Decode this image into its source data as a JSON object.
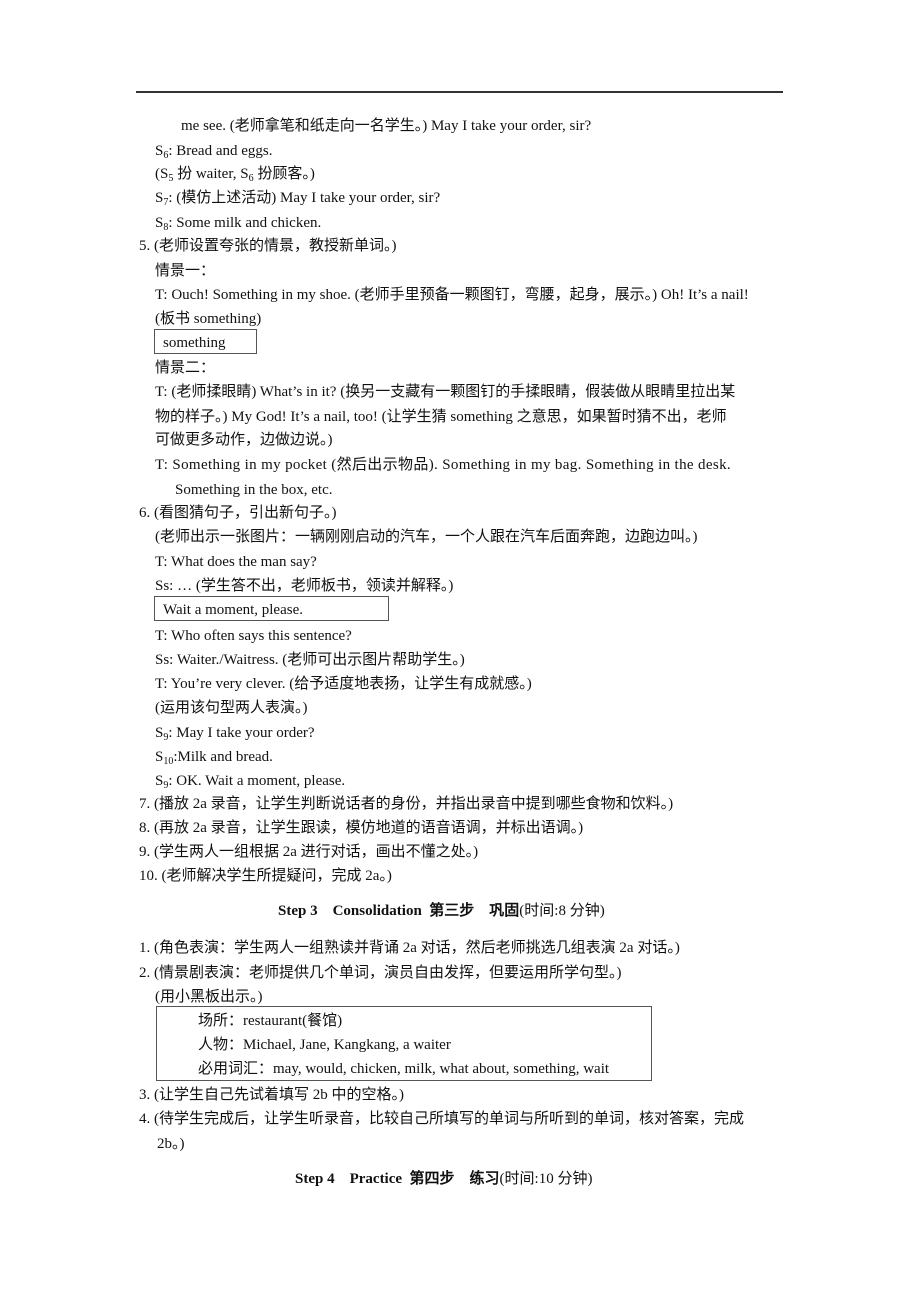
{
  "document": {
    "lines": {
      "l01": "me see. (老师拿笔和纸走向一名学生。) May I take your order, sir?",
      "l02_speaker": "S",
      "l02_sub": "6",
      "l02_text": ": Bread and eggs.",
      "l03_a": "(S",
      "l03_sub1": "5",
      "l03_b": " 扮 waiter, S",
      "l03_sub2": "6",
      "l03_c": " 扮顾客。)",
      "l04_speaker": "S",
      "l04_sub": "7",
      "l04_text": ": (模仿上述活动) May I take your order, sir?",
      "l05_speaker": "S",
      "l05_sub": "8",
      "l05_text": ": Some milk and chicken.",
      "l06": "5. (老师设置夸张的情景，教授新单词。)",
      "l07": "情景一：",
      "l08": "T: Ouch! Something in my shoe. (老师手里预备一颗图钉，弯腰，起身，展示。) Oh! It’s a nail!",
      "l09": "(板书 something)",
      "box1": "something",
      "l10": "情景二：",
      "l11": "T: (老师揉眼睛) What’s in it? (换另一支藏有一颗图钉的手揉眼睛，假装做从眼睛里拉出某",
      "l12": "物的样子。) My God! It’s a nail, too! (让学生猜 something 之意思，如果暂时猜不出，老师",
      "l13": "可做更多动作，边做边说。)",
      "l14": "T: Something in my pocket (然后出示物品). Something in my bag. Something in the desk.",
      "l15": "Something in the box, etc.",
      "l16": "6. (看图猜句子，引出新句子。)",
      "l17": "(老师出示一张图片：一辆刚刚启动的汽车，一个人跟在汽车后面奔跑，边跑边叫。)",
      "l18": "T: What does the man say?",
      "l19": "Ss: … (学生答不出，老师板书，领读并解释。)",
      "box2": "Wait a moment, please.",
      "l20": "T: Who often says this sentence?",
      "l21": "Ss: Waiter./Waitress. (老师可出示图片帮助学生。)",
      "l22": "T: You’re very clever. (给予适度地表扬，让学生有成就感。)",
      "l23": "(运用该句型两人表演。)",
      "l24_speaker": "S",
      "l24_sub": "9",
      "l24_text": ":  May I take your order?",
      "l25_speaker": "S",
      "l25_sub": "10",
      "l25_text": ":Milk and bread.",
      "l26_speaker": "S",
      "l26_sub": "9",
      "l26_text": ": OK. Wait a moment, please.",
      "l27": "7. (播放 2a 录音，让学生判断说话者的身份，并指出录音中提到哪些食物和饮料。)",
      "l28": "8. (再放 2a 录音，让学生跟读，模仿地道的语音语调，并标出语调。)",
      "l29": "9. (学生两人一组根据 2a 进行对话，画出不懂之处。)",
      "l30": "10. (老师解决学生所提疑问，完成 2a。)"
    },
    "step3": {
      "title_bold": "Step 3    Consolidation  第三步    巩固",
      "title_normal": "(时间:8 分钟)",
      "l1": "1. (角色表演：学生两人一组熟读并背诵 2a 对话，然后老师挑选几组表演 2a 对话。)",
      "l2": "2. (情景剧表演：老师提供几个单词，演员自由发挥，但要运用所学句型。)",
      "l3": "(用小黑板出示。)",
      "box": {
        "place": "场所：restaurant(餐馆)",
        "people": "人物：Michael, Jane, Kangkang, a waiter",
        "vocab": "必用词汇：may, would, chicken, milk, what about, something, wait"
      },
      "l4": "3. (让学生自己先试着填写 2b 中的空格。)",
      "l5": "4. (待学生完成后，让学生听录音，比较自己所填写的单词与所听到的单词，核对答案，完成",
      "l6": "2b。)"
    },
    "step4": {
      "title_bold": "Step 4    Practice  第四步    练习",
      "title_normal": "(时间:10 分钟)"
    }
  }
}
